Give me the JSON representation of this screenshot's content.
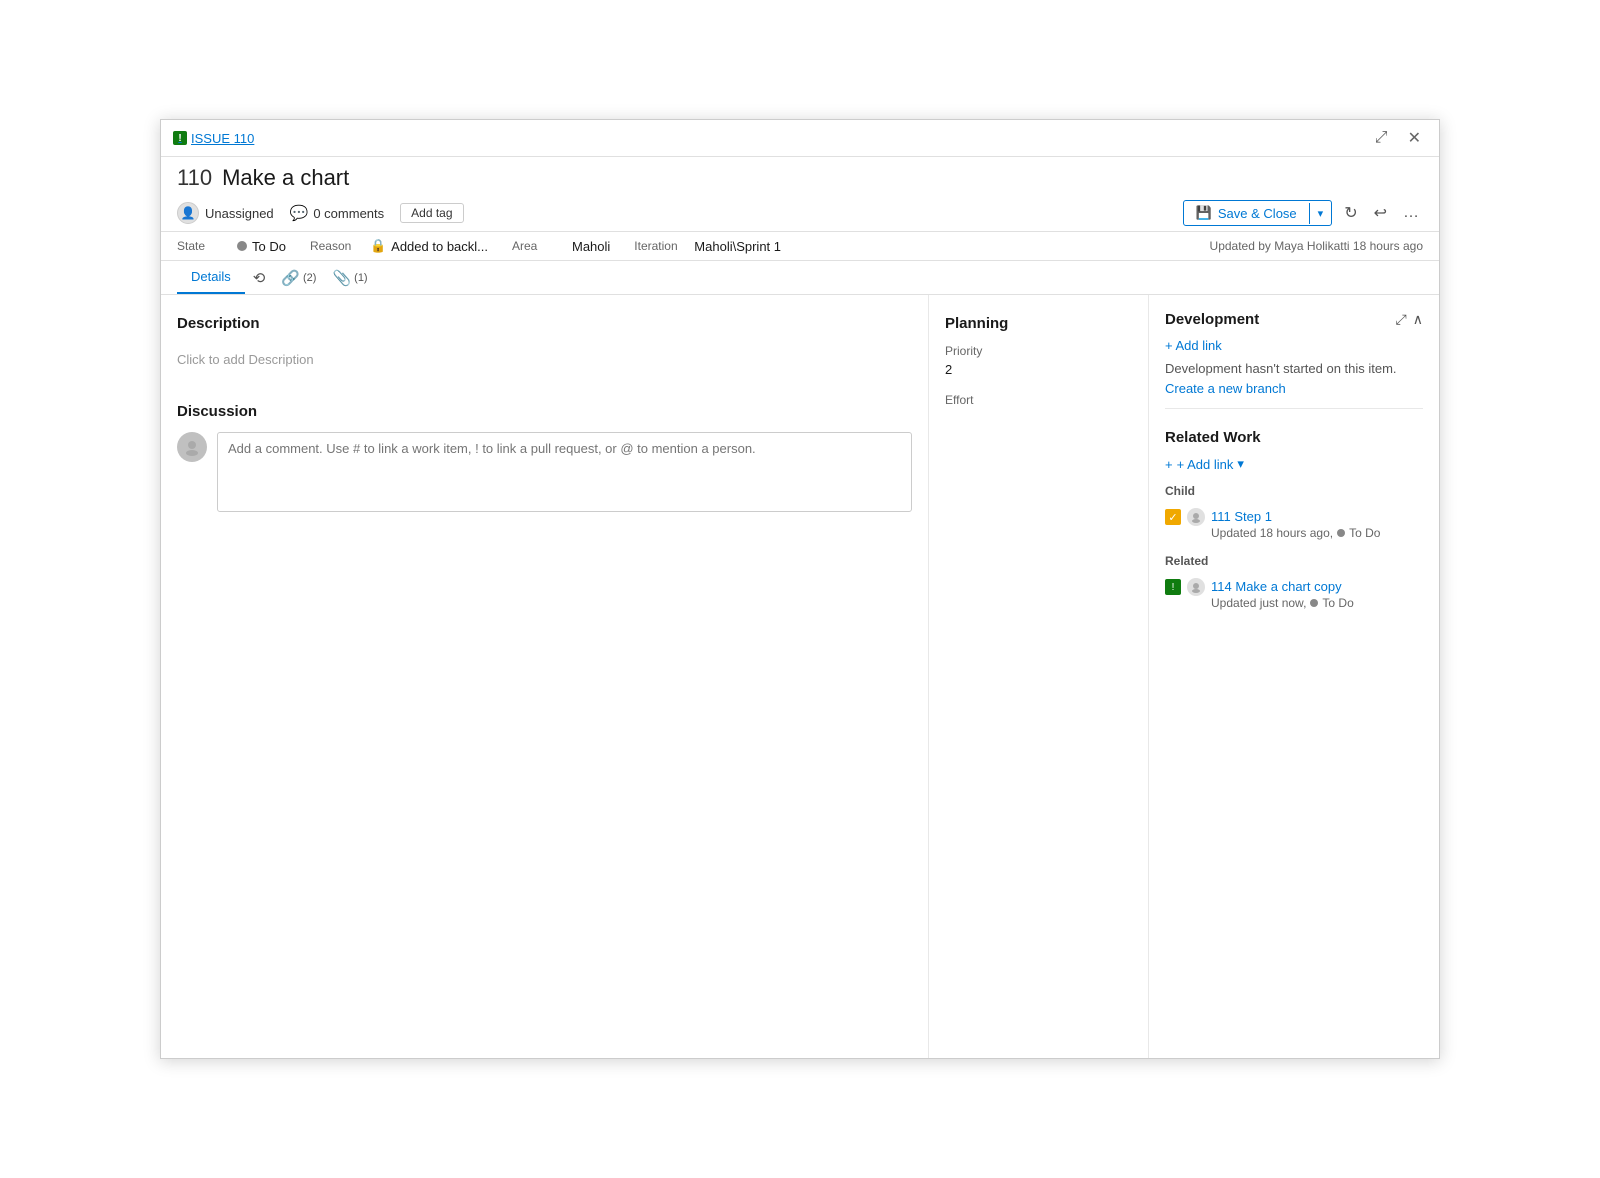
{
  "window": {
    "issue_tag": "ISSUE 110",
    "title_number": "110",
    "title_name": "Make a chart",
    "expand_icon": "⤢",
    "close_icon": "✕"
  },
  "header": {
    "unassigned_label": "Unassigned",
    "comments_count": "0 comments",
    "add_tag_label": "Add tag",
    "save_close_label": "Save & Close",
    "save_close_dropdown": "▾",
    "refresh_icon": "↻",
    "undo_icon": "↩",
    "more_icon": "…"
  },
  "state_bar": {
    "state_label": "State",
    "state_value": "To Do",
    "reason_label": "Reason",
    "reason_value": "Added to backl...",
    "area_label": "Area",
    "area_value": "Maholi",
    "iteration_label": "Iteration",
    "iteration_value": "Maholi\\Sprint 1",
    "updated_text": "Updated by Maya Holikatti 18 hours ago"
  },
  "tabs": {
    "details_label": "Details",
    "history_icon": "⟲",
    "links_label": "(2)",
    "attachments_label": "(1)"
  },
  "description": {
    "section_title": "Description",
    "placeholder": "Click to add Description"
  },
  "discussion": {
    "section_title": "Discussion",
    "comment_placeholder": "Add a comment. Use # to link a work item, ! to link a pull request, or @ to mention a person."
  },
  "planning": {
    "section_title": "Planning",
    "priority_label": "Priority",
    "priority_value": "2",
    "effort_label": "Effort",
    "effort_value": ""
  },
  "development": {
    "section_title": "Development",
    "add_link_label": "+ Add link",
    "not_started_text": "Development hasn't started on this item.",
    "create_branch_label": "Create a new branch"
  },
  "related_work": {
    "section_title": "Related Work",
    "add_link_label": "+ Add link",
    "child_label": "Child",
    "child_item_number": "111",
    "child_item_name": "Step 1",
    "child_item_meta": "Updated 18 hours ago,",
    "child_item_status": "To Do",
    "related_label": "Related",
    "related_item_number": "114",
    "related_item_name": "Make a chart copy",
    "related_item_meta": "Updated just now,",
    "related_item_status": "To Do"
  }
}
